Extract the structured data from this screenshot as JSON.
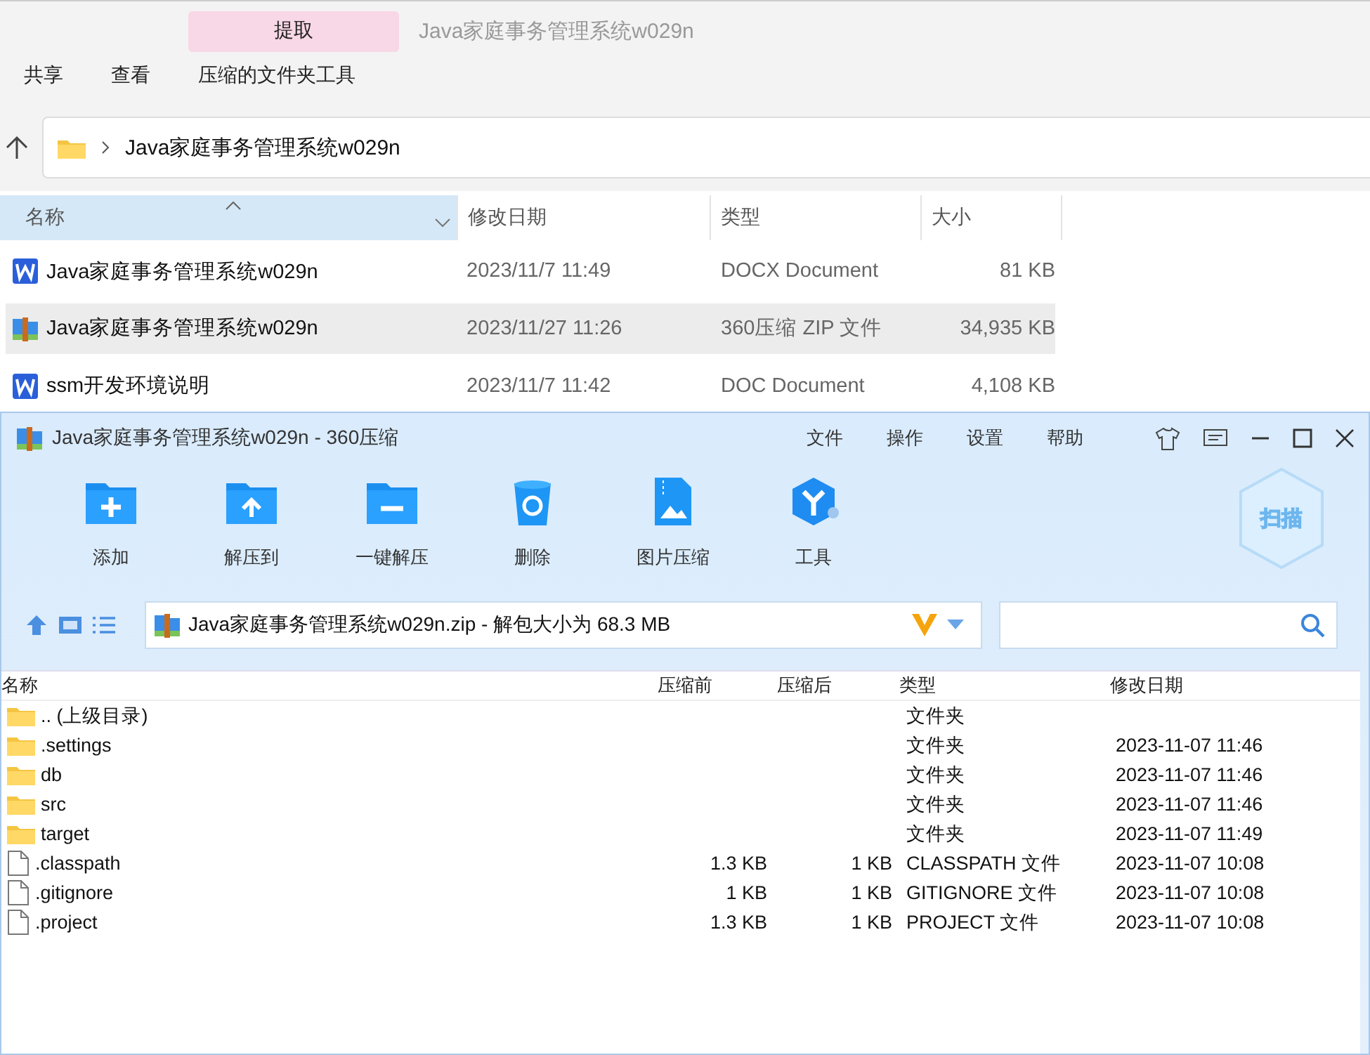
{
  "explorer": {
    "context_tab": "提取",
    "window_title": "Java家庭事务管理系统w029n",
    "ribbon_menu": [
      "共享",
      "查看",
      "压缩的文件夹工具"
    ],
    "address": {
      "path": "Java家庭事务管理系统w029n"
    },
    "columns": [
      {
        "label": "名称",
        "sorted": true
      },
      {
        "label": "修改日期",
        "sorted": false
      },
      {
        "label": "类型",
        "sorted": false
      },
      {
        "label": "大小",
        "sorted": false
      }
    ],
    "files": [
      {
        "kind": "word",
        "name": "Java家庭事务管理系统w029n",
        "date": "2023/11/7 11:49",
        "type": "DOCX Document",
        "size": "81 KB",
        "selected": false
      },
      {
        "kind": "zip",
        "name": "Java家庭事务管理系统w029n",
        "date": "2023/11/27 11:26",
        "type": "360压缩 ZIP 文件",
        "size": "34,935 KB",
        "selected": true
      },
      {
        "kind": "word",
        "name": "ssm开发环境说明",
        "date": "2023/11/7 11:42",
        "type": "DOC Document",
        "size": "4,108 KB",
        "selected": false
      }
    ]
  },
  "zip_app": {
    "title": "Java家庭事务管理系统w029n - 360压缩",
    "menu": [
      "文件",
      "操作",
      "设置",
      "帮助"
    ],
    "tools": [
      {
        "kind": "add",
        "label": "添加"
      },
      {
        "kind": "extract",
        "label": "解压到"
      },
      {
        "kind": "oneclick",
        "label": "一键解压"
      },
      {
        "kind": "delete",
        "label": "删除"
      },
      {
        "kind": "image",
        "label": "图片压缩"
      },
      {
        "kind": "tools",
        "label": "工具"
      }
    ],
    "scan_label": "扫描",
    "path": "Java家庭事务管理系统w029n.zip - 解包大小为 68.3 MB",
    "columns": [
      "名称",
      "压缩前",
      "压缩后",
      "类型",
      "修改日期"
    ],
    "files": [
      {
        "kind": "folder",
        "name": ".. (上级目录)",
        "type": "文件夹"
      },
      {
        "kind": "folder",
        "name": ".settings",
        "type": "文件夹",
        "date": "2023-11-07 11:46"
      },
      {
        "kind": "folder",
        "name": "db",
        "type": "文件夹",
        "date": "2023-11-07 11:46"
      },
      {
        "kind": "folder",
        "name": "src",
        "type": "文件夹",
        "date": "2023-11-07 11:46"
      },
      {
        "kind": "folder",
        "name": "target",
        "type": "文件夹",
        "date": "2023-11-07 11:49"
      },
      {
        "kind": "file",
        "name": ".classpath",
        "before": "1.3 KB",
        "after": "1 KB",
        "type": "CLASSPATH 文件",
        "date": "2023-11-07 10:08"
      },
      {
        "kind": "file",
        "name": ".gitignore",
        "before": "1 KB",
        "after": "1 KB",
        "type": "GITIGNORE 文件",
        "date": "2023-11-07 10:08"
      },
      {
        "kind": "file",
        "name": ".project",
        "before": "1.3 KB",
        "after": "1 KB",
        "type": "PROJECT 文件",
        "date": "2023-11-07 10:08"
      }
    ]
  }
}
